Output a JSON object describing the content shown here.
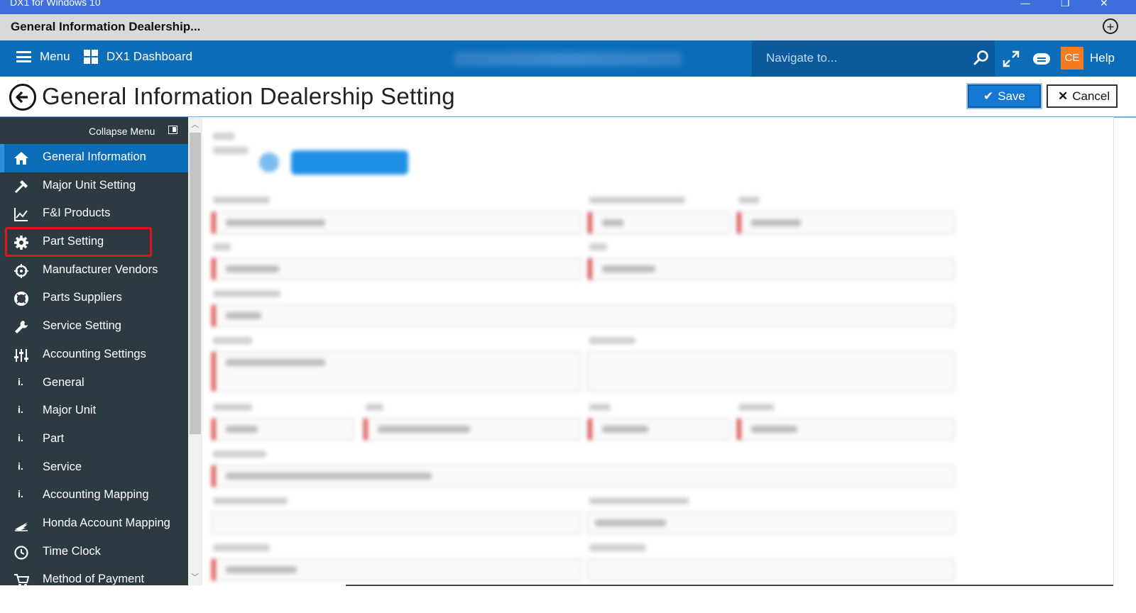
{
  "window": {
    "title": "DX1 for Windows 10",
    "tab_title": "General Information Dealership..."
  },
  "navbar": {
    "menu_label": "Menu",
    "dashboard_label": "DX1 Dashboard",
    "search_placeholder": "Navigate to...",
    "avatar_initials": "CE",
    "help_label": "Help"
  },
  "page": {
    "title": "General Information Dealership Setting",
    "save_label": "Save",
    "cancel_label": "Cancel"
  },
  "sidebar": {
    "collapse_label": "Collapse Menu",
    "items": [
      {
        "label": "General Information",
        "icon": "home-icon",
        "active": true
      },
      {
        "label": "Major Unit Setting",
        "icon": "hammer-icon"
      },
      {
        "label": "F&I Products",
        "icon": "line-chart-icon"
      },
      {
        "label": "Part Setting",
        "icon": "gear-icon",
        "highlighted": true
      },
      {
        "label": "Manufacturer Vendors",
        "icon": "crosshair-icon"
      },
      {
        "label": "Parts Suppliers",
        "icon": "lifebuoy-icon"
      },
      {
        "label": "Service Setting",
        "icon": "wrench-icon"
      },
      {
        "label": "Accounting Settings",
        "icon": "sliders-icon"
      },
      {
        "label": "General",
        "icon": "sub-item-icon"
      },
      {
        "label": "Major Unit",
        "icon": "sub-item-icon"
      },
      {
        "label": "Part",
        "icon": "sub-item-icon"
      },
      {
        "label": "Service",
        "icon": "sub-item-icon"
      },
      {
        "label": "Accounting Mapping",
        "icon": "sub-item-icon"
      },
      {
        "label": "Honda Account Mapping",
        "icon": "honda-wing-icon"
      },
      {
        "label": "Time Clock",
        "icon": "clock-icon"
      },
      {
        "label": "Method of Payment",
        "icon": "cart-icon"
      }
    ]
  },
  "colors": {
    "titlebar": "#3d6fdc",
    "navbar": "#0b6cb8",
    "sidebar": "#2c3a42",
    "active_item": "#0b6cb8",
    "avatar": "#f47b20",
    "highlight_box": "#e0141e"
  }
}
